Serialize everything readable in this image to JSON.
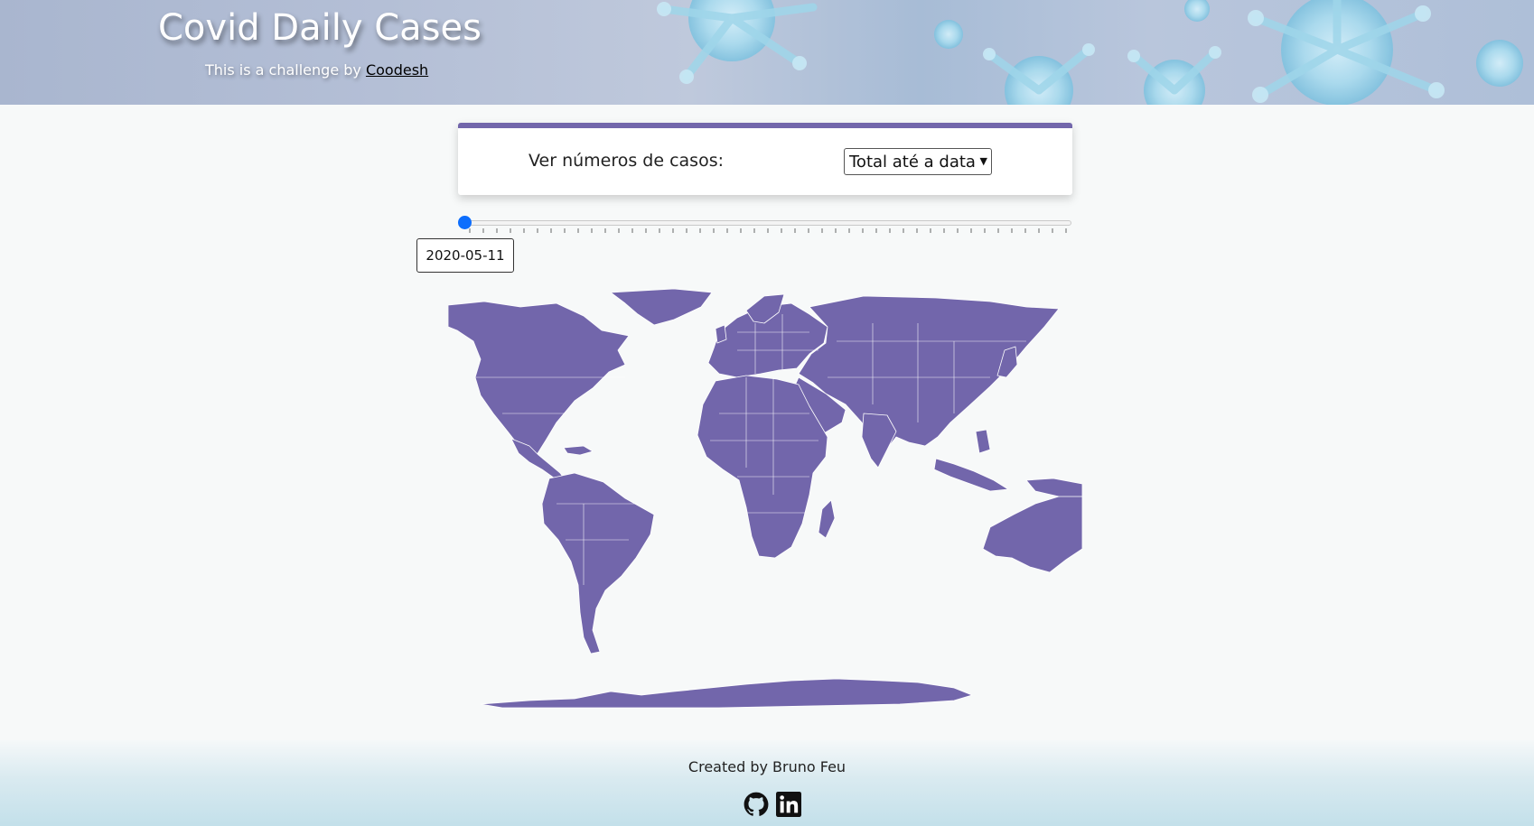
{
  "header": {
    "title": "Covid Daily Cases",
    "subtitle_prefix": "This is a challenge by ",
    "subtitle_link": "Coodesh"
  },
  "filter": {
    "label": "Ver números de casos:",
    "selected_option": "Total até a data"
  },
  "timeline": {
    "current_date": "2020-05-11",
    "position": 0
  },
  "map": {
    "fill_color": "#7266ab",
    "border_color": "#ffffff"
  },
  "footer": {
    "credit": "Created by Bruno Feu",
    "icons": [
      "github-icon",
      "linkedin-icon"
    ]
  },
  "colors": {
    "accent": "#7266ab",
    "slider_thumb": "#0d6efd"
  }
}
